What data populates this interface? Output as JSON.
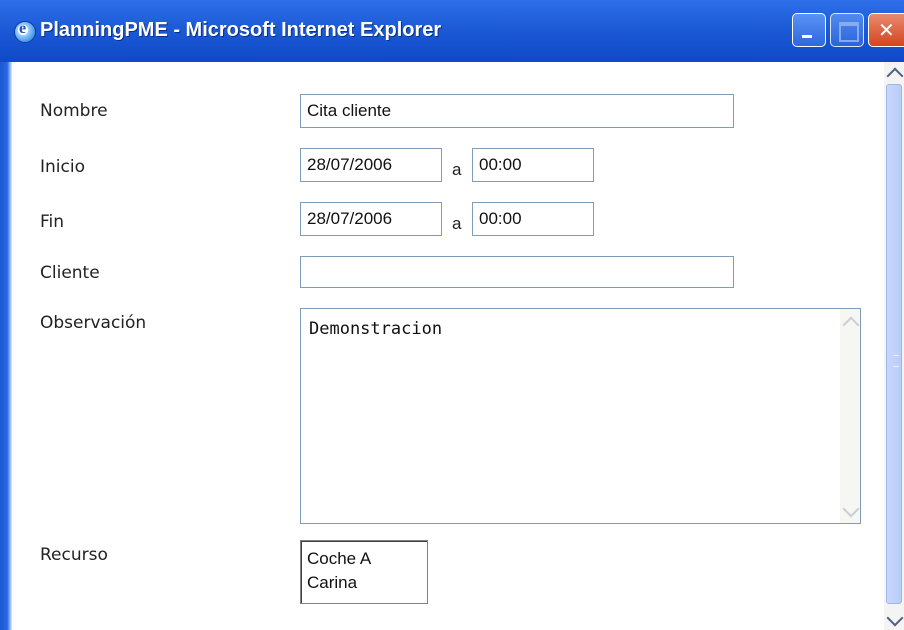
{
  "window": {
    "title": "PlanningPME - Microsoft Internet Explorer",
    "title_icon": "ie-icon"
  },
  "form": {
    "nombre": {
      "label": "Nombre",
      "value": "Cita cliente"
    },
    "inicio": {
      "label": "Inicio",
      "date": "28/07/2006",
      "separator": "a",
      "time": "00:00"
    },
    "fin": {
      "label": "Fin",
      "date": "28/07/2006",
      "separator": "a",
      "time": "00:00"
    },
    "cliente": {
      "label": "Cliente",
      "value": ""
    },
    "observacion": {
      "label": "Observación",
      "value": "Demonstracion"
    },
    "recurso": {
      "label": "Recurso",
      "options": [
        "Coche A",
        "Carina"
      ]
    }
  },
  "colors": {
    "titlebar": "#1c5ad6",
    "field_border": "#7f9db9"
  }
}
